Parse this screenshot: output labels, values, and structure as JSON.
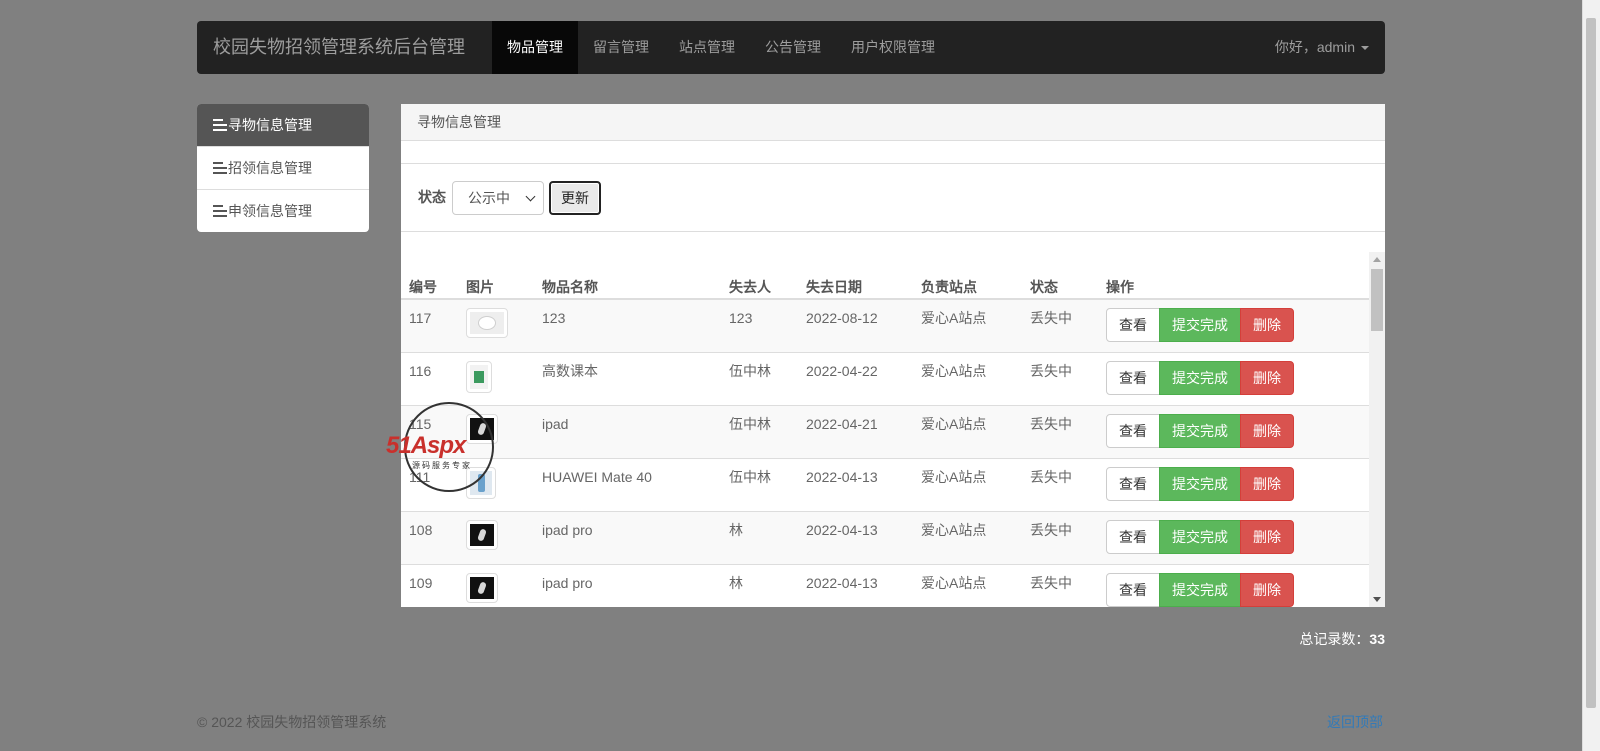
{
  "navbar": {
    "brand": "校园失物招领管理系统后台管理",
    "items": [
      "物品管理",
      "留言管理",
      "站点管理",
      "公告管理",
      "用户权限管理"
    ],
    "user": "你好，admin"
  },
  "sidebar": {
    "items": [
      "寻物信息管理",
      "招领信息管理",
      "申领信息管理"
    ]
  },
  "panel": {
    "heading": "寻物信息管理",
    "filter": {
      "label": "状态",
      "selected": "公示中",
      "button": "更新"
    },
    "table": {
      "columns": [
        "编号",
        "图片",
        "物品名称",
        "失去人",
        "失去日期",
        "负责站点",
        "状态",
        "操作"
      ],
      "rows": [
        {
          "id": "117",
          "name": "123",
          "loser": "123",
          "date": "2022-08-12",
          "site": "爱心A站点",
          "status": "丢失中"
        },
        {
          "id": "116",
          "name": "高数课本",
          "loser": "伍中林",
          "date": "2022-04-22",
          "site": "爱心A站点",
          "status": "丢失中"
        },
        {
          "id": "115",
          "name": "ipad",
          "loser": "伍中林",
          "date": "2022-04-21",
          "site": "爱心A站点",
          "status": "丢失中"
        },
        {
          "id": "111",
          "name": "HUAWEI Mate 40",
          "loser": "伍中林",
          "date": "2022-04-13",
          "site": "爱心A站点",
          "status": "丢失中"
        },
        {
          "id": "108",
          "name": "ipad pro",
          "loser": "林",
          "date": "2022-04-13",
          "site": "爱心A站点",
          "status": "丢失中"
        },
        {
          "id": "109",
          "name": "ipad pro",
          "loser": "林",
          "date": "2022-04-13",
          "site": "爱心A站点",
          "status": "丢失中"
        }
      ],
      "actions": {
        "view": "查看",
        "done": "提交完成",
        "delete": "删除"
      }
    }
  },
  "total": {
    "label": "总记录数：",
    "count": "33"
  },
  "footer": {
    "copyright": "© 2022 校园失物招领管理系统",
    "back_to_top": "返回顶部"
  },
  "watermark": {
    "logo": "51Aspx",
    "tagline": "源码服务专家"
  },
  "colors": {
    "navbar": "#222222",
    "success": "#5cb85c",
    "danger": "#d9534f",
    "link": "#337ab7",
    "background": "#808080"
  }
}
